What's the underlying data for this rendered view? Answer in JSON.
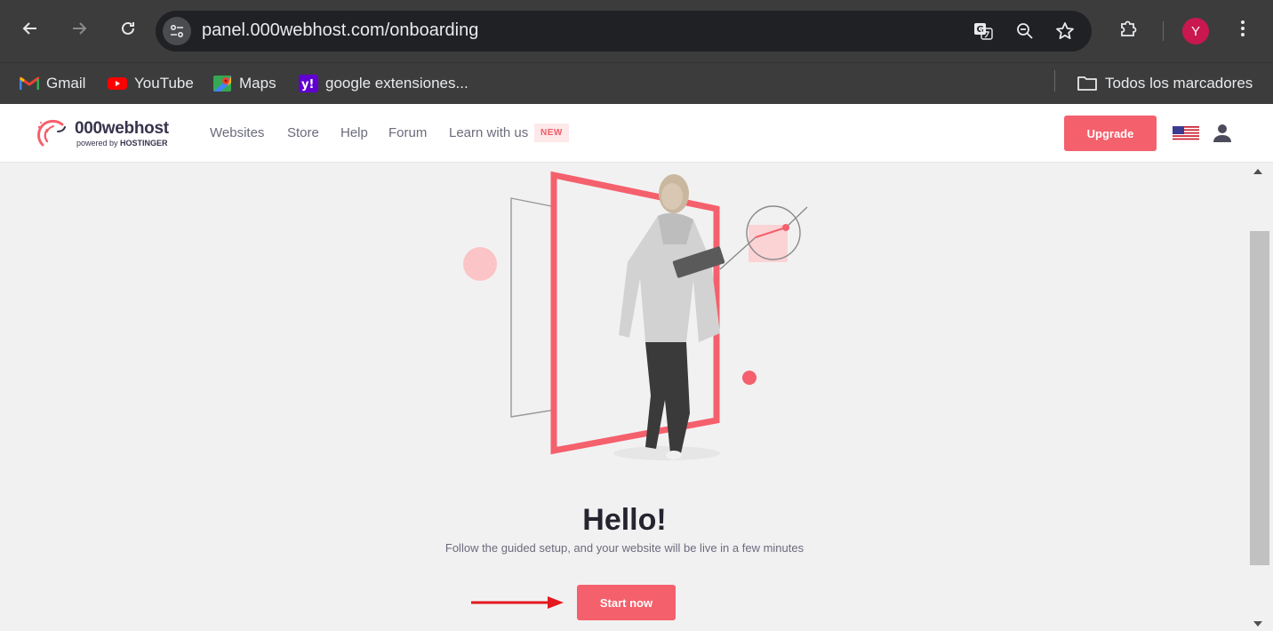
{
  "browser": {
    "url": "panel.000webhost.com/onboarding",
    "profile_initial": "Y",
    "bookmarks": [
      {
        "label": "Gmail",
        "icon": "gmail-icon"
      },
      {
        "label": "YouTube",
        "icon": "youtube-icon"
      },
      {
        "label": "Maps",
        "icon": "maps-icon"
      },
      {
        "label": "google extensiones...",
        "icon": "yahoo-icon"
      }
    ],
    "all_bookmarks_label": "Todos los marcadores"
  },
  "site": {
    "logo": {
      "name": "000webhost",
      "tagline_prefix": "powered by",
      "tagline_brand": "HOSTINGER"
    },
    "nav": [
      "Websites",
      "Store",
      "Help",
      "Forum",
      "Learn with us"
    ],
    "new_badge": "NEW",
    "upgrade_label": "Upgrade"
  },
  "main": {
    "title": "Hello!",
    "subtitle": "Follow the guided setup, and your website will be live in a few minutes",
    "cta_label": "Start now"
  },
  "colors": {
    "accent": "#f4606c",
    "chrome": "#3c3c3c",
    "omnibox": "#202124",
    "avatar": "#c8184f"
  }
}
